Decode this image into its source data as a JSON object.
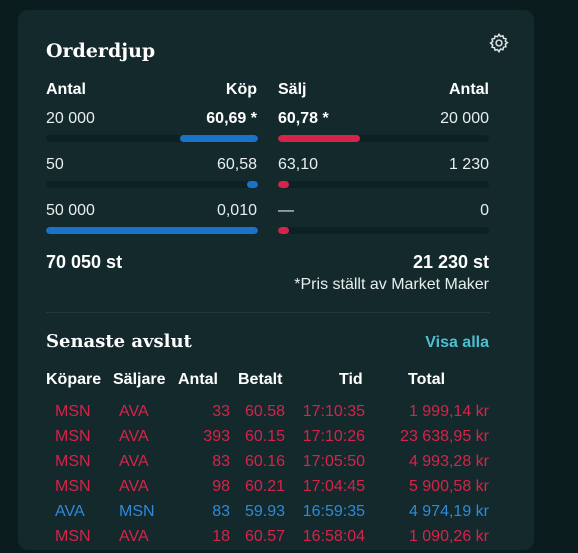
{
  "orderbook": {
    "title": "Orderdjup",
    "headers": {
      "buy_qty": "Antal",
      "buy_price": "Köp",
      "sell_price": "Sälj",
      "sell_qty": "Antal"
    },
    "rows": [
      {
        "buy_qty": "20 000",
        "buy_price": "60,69 *",
        "sell_price": "60,78 *",
        "sell_qty": "20 000",
        "buy_level": 0.37,
        "sell_level": 0.39,
        "highlight": true
      },
      {
        "buy_qty": "50",
        "buy_price": "60,58",
        "sell_price": "63,10",
        "sell_qty": "1 230",
        "buy_level": 0.05,
        "sell_level": 0.05,
        "highlight": false
      },
      {
        "buy_qty": "50 000",
        "buy_price": "0,010",
        "sell_price": "—",
        "sell_qty": "0",
        "buy_level": 1.0,
        "sell_level": 0.05,
        "highlight": false
      }
    ],
    "total_buy": "70 050 st",
    "total_sell": "21 230 st",
    "note": "*Pris ställt av Market Maker",
    "colors": {
      "buy": "#1a73c9",
      "sell": "#d6234a"
    }
  },
  "trades": {
    "title": "Senaste avslut",
    "view_all": "Visa alla",
    "headers": {
      "buyer": "Köpare",
      "seller": "Säljare",
      "qty": "Antal",
      "price": "Betalt",
      "time": "Tid",
      "total": "Total"
    },
    "rows": [
      {
        "buyer": "MSN",
        "seller": "AVA",
        "qty": "33",
        "price": "60.58",
        "time": "17:10:35",
        "total": "1 999,14 kr",
        "side": "sell"
      },
      {
        "buyer": "MSN",
        "seller": "AVA",
        "qty": "393",
        "price": "60.15",
        "time": "17:10:26",
        "total": "23 638,95 kr",
        "side": "sell"
      },
      {
        "buyer": "MSN",
        "seller": "AVA",
        "qty": "83",
        "price": "60.16",
        "time": "17:05:50",
        "total": "4 993,28 kr",
        "side": "sell"
      },
      {
        "buyer": "MSN",
        "seller": "AVA",
        "qty": "98",
        "price": "60.21",
        "time": "17:04:45",
        "total": "5 900,58 kr",
        "side": "sell"
      },
      {
        "buyer": "AVA",
        "seller": "MSN",
        "qty": "83",
        "price": "59.93",
        "time": "16:59:35",
        "total": "4 974,19 kr",
        "side": "buy"
      },
      {
        "buyer": "MSN",
        "seller": "AVA",
        "qty": "18",
        "price": "60.57",
        "time": "16:58:04",
        "total": "1 090,26 kr",
        "side": "sell"
      }
    ]
  },
  "icons": {
    "settings": "gear-icon"
  }
}
